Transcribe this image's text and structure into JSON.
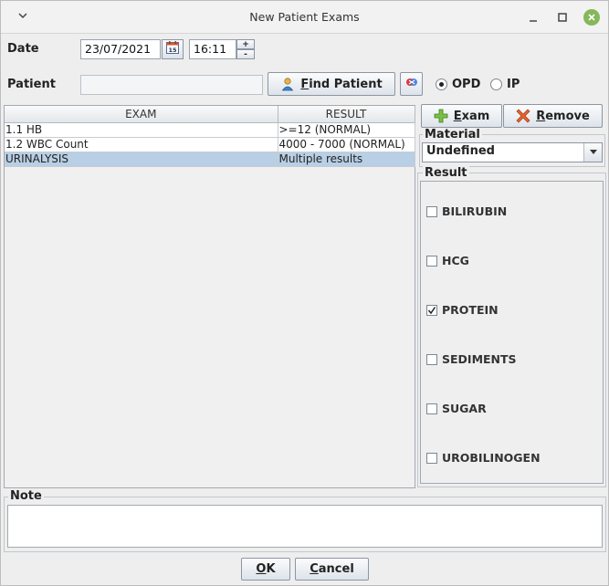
{
  "window": {
    "title": "New Patient Exams"
  },
  "date": {
    "label": "Date",
    "value": "23/07/2021",
    "time": "16:11",
    "spin_up": "+",
    "spin_down": "-"
  },
  "patient": {
    "label": "Patient",
    "value": "",
    "find_button": "Find Patient",
    "find_mnemonic": "F",
    "find_rest": "ind Patient"
  },
  "visit_type": {
    "options": [
      "OPD",
      "IP"
    ],
    "selected": "OPD"
  },
  "exam_table": {
    "columns": [
      "EXAM",
      "RESULT"
    ],
    "rows": [
      {
        "exam": "1.1 HB",
        "result": ">=12 (NORMAL)"
      },
      {
        "exam": "1.2 WBC Count",
        "result": "4000 - 7000 (NORMAL)"
      },
      {
        "exam": "URINALYSIS",
        "result": "Multiple results"
      }
    ],
    "selected_row": 2
  },
  "actions": {
    "exam_mnemonic": "E",
    "exam_rest": "xam",
    "remove_mnemonic": "R",
    "remove_rest": "emove"
  },
  "material": {
    "label": "Material",
    "selected": "Undefined"
  },
  "result": {
    "label": "Result",
    "items": [
      {
        "name": "BILIRUBIN",
        "checked": false
      },
      {
        "name": "HCG",
        "checked": false
      },
      {
        "name": "PROTEIN",
        "checked": true
      },
      {
        "name": "SEDIMENTS",
        "checked": false
      },
      {
        "name": "SUGAR",
        "checked": false
      },
      {
        "name": "UROBILINOGEN",
        "checked": false
      }
    ]
  },
  "note": {
    "label": "Note",
    "value": ""
  },
  "footer": {
    "ok_mnemonic": "O",
    "ok_rest": "K",
    "cancel_mnemonic": "C",
    "cancel_rest": "ancel"
  },
  "colors": {
    "selection": "#b8cfe5",
    "close_button": "#86b75a"
  },
  "icons": {
    "window_menu": "chevron-down-icon",
    "minimize": "minimize-icon",
    "maximize": "maximize-icon",
    "close": "close-icon",
    "calendar": "calendar-icon",
    "find": "person-search-icon",
    "clear": "clear-patient-icon",
    "add": "plus-icon",
    "remove": "x-icon",
    "dropdown": "chevron-down-icon"
  }
}
